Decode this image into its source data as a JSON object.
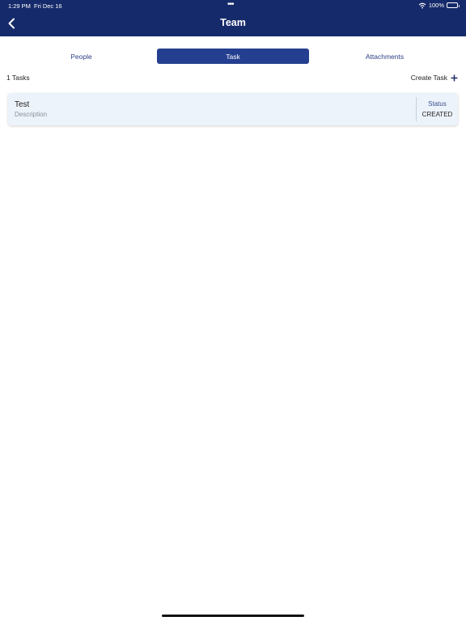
{
  "status_bar": {
    "time": "1:29 PM",
    "date": "Fri Dec 16",
    "battery": "100%",
    "more_dots": "•••"
  },
  "header": {
    "title": "Team",
    "background_color": "#152a6a",
    "back_icon": "chevron-left-icon"
  },
  "tabs": [
    {
      "label": "People",
      "selected": false
    },
    {
      "label": "Task",
      "selected": true
    },
    {
      "label": "Attachments",
      "selected": false
    }
  ],
  "tasks_summary": {
    "count_label": "1 Tasks",
    "create_label": "Create Task",
    "create_icon": "plus-icon"
  },
  "tasks": [
    {
      "title": "Test",
      "description": "Description",
      "status_label": "Status",
      "status_value": "CREATED"
    }
  ],
  "colors": {
    "accent": "#253f90",
    "card_background": "#edf3fa"
  }
}
